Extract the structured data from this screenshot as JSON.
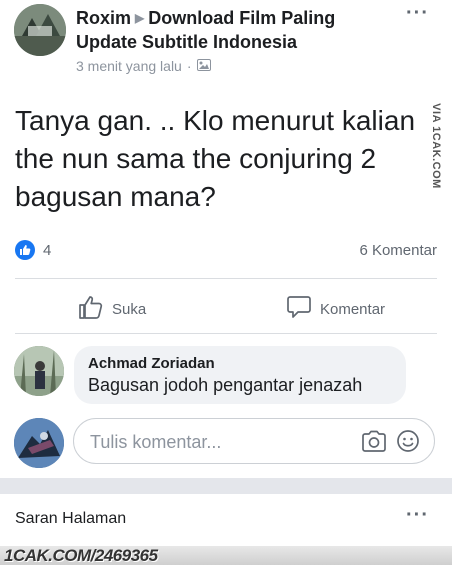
{
  "post": {
    "author": "Roxim",
    "group": "Download Film Paling Update Subtitle Indonesia",
    "timestamp": "3 menit yang lalu",
    "text": "Tanya gan. .. Klo menurut kalian the nun sama the conjuring 2 bagusan mana?",
    "likes": "4",
    "comments_count": "6 Komentar"
  },
  "actions": {
    "like": "Suka",
    "comment": "Komentar"
  },
  "comment": {
    "name": "Achmad Zoriadan",
    "text": "Bagusan jodoh pengantar jenazah"
  },
  "composer": {
    "placeholder": "Tulis komentar..."
  },
  "suggestions": {
    "title": "Saran Halaman"
  },
  "watermarks": {
    "side": "VIA 1CAK.COM",
    "footer": "1CAK.COM/2469365"
  },
  "colors": {
    "like_blue": "#1877f2",
    "text": "#1c1e21",
    "muted": "#606770"
  }
}
